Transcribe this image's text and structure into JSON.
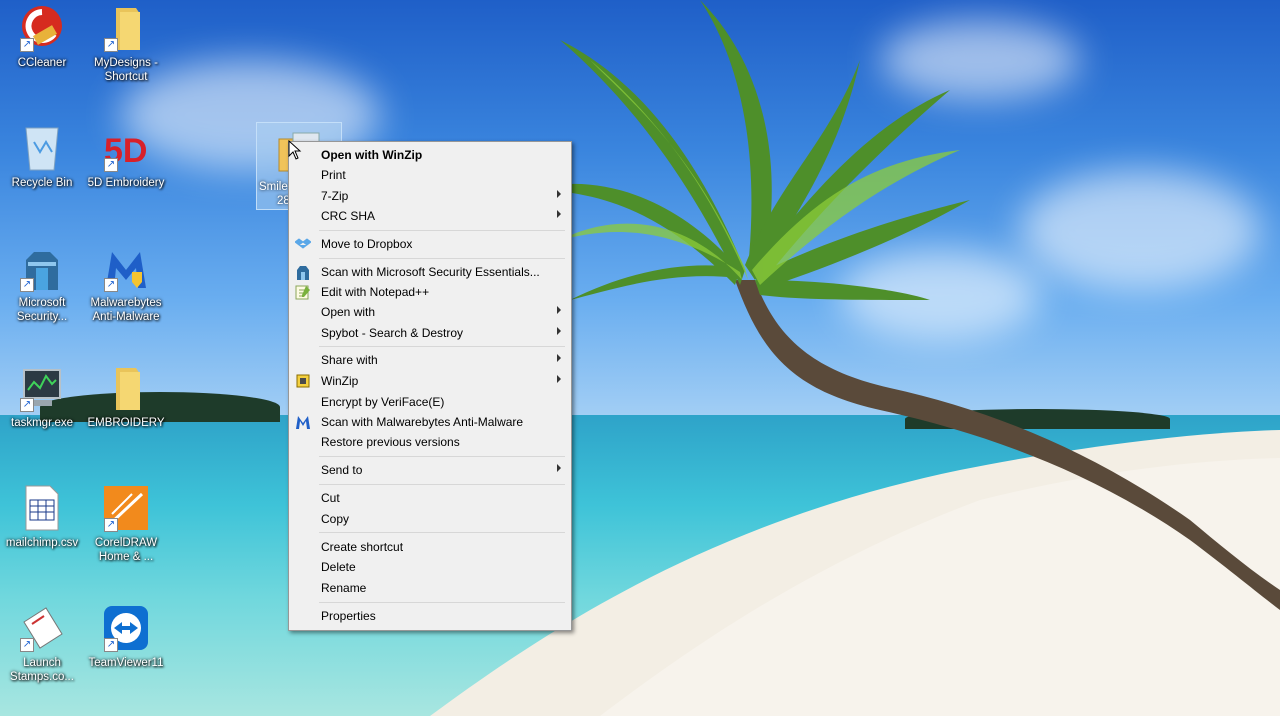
{
  "desktop": {
    "icons": [
      {
        "label": "CCleaner",
        "icon": "ccleaner-icon"
      },
      {
        "label": "MyDesigns - Shortcut",
        "icon": "folder-icon"
      },
      {
        "label": "Recycle Bin",
        "icon": "recycle-bin-icon"
      },
      {
        "label": "5D Embroidery",
        "icon": "5d-embroidery-icon",
        "badge": "5D"
      },
      {
        "label": "Microsoft Security...",
        "icon": "microsoft-security-icon"
      },
      {
        "label": "Malwarebytes Anti-Malware",
        "icon": "malwarebytes-icon"
      },
      {
        "label": "taskmgr.exe",
        "icon": "task-manager-icon"
      },
      {
        "label": "EMBROIDERY",
        "icon": "folder-icon"
      },
      {
        "label": "mailchimp.csv",
        "icon": "csv-file-icon"
      },
      {
        "label": "CorelDRAW Home & ...",
        "icon": "coreldraw-icon"
      },
      {
        "label": "Launch Stamps.co...",
        "icon": "stamps-icon"
      },
      {
        "label": "TeamViewer11",
        "icon": "teamviewer-icon"
      }
    ],
    "selected_file": {
      "label_line1": "Smile",
      "label_line2": "28",
      "icon": "zip-archive-icon"
    }
  },
  "context_menu": {
    "items": [
      {
        "label": "Open with WinZip",
        "bold": true
      },
      {
        "label": "Print"
      },
      {
        "label": "7-Zip",
        "submenu": true
      },
      {
        "label": "CRC SHA",
        "submenu": true
      },
      {
        "label": "Move to Dropbox",
        "icon": "dropbox-icon"
      },
      {
        "label": "Scan with Microsoft Security Essentials...",
        "icon": "security-essentials-icon"
      },
      {
        "label": "Edit with Notepad++",
        "icon": "notepad-plus-plus-icon"
      },
      {
        "label": "Open with",
        "submenu": true
      },
      {
        "label": "Spybot - Search & Destroy",
        "submenu": true
      },
      {
        "label": "Share with",
        "submenu": true
      },
      {
        "label": "WinZip",
        "icon": "winzip-icon",
        "submenu": true
      },
      {
        "label": "Encrypt by VeriFace(E)"
      },
      {
        "label": "Scan with Malwarebytes Anti-Malware",
        "icon": "malwarebytes-icon"
      },
      {
        "label": "Restore previous versions"
      },
      {
        "label": "Send to",
        "submenu": true
      },
      {
        "label": "Cut"
      },
      {
        "label": "Copy"
      },
      {
        "label": "Create shortcut"
      },
      {
        "label": "Delete"
      },
      {
        "label": "Rename"
      },
      {
        "label": "Properties"
      }
    ]
  },
  "colors": {
    "menu_bg": "#f0f0f0",
    "menu_border": "#979797",
    "separator": "#d7d7d7",
    "selection_highlight": "#aacdf0"
  }
}
